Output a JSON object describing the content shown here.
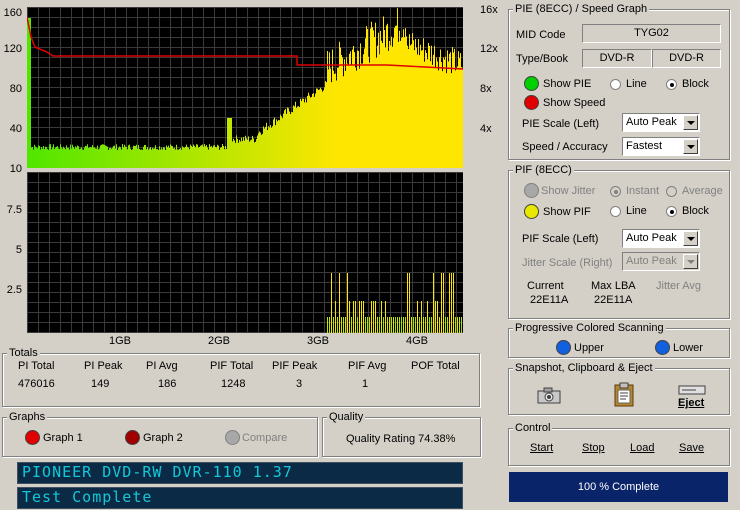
{
  "top_chart": {
    "left_axis": [
      "160",
      "120",
      "80",
      "40",
      "10"
    ],
    "right_axis": [
      "16x",
      "12x",
      "8x",
      "4x"
    ]
  },
  "bottom_chart": {
    "left_axis": [
      "7.5",
      "5",
      "2.5"
    ],
    "x_axis": [
      "1GB",
      "2GB",
      "3GB",
      "4GB"
    ]
  },
  "pie_panel": {
    "title": "PIE (8ECC) / Speed Graph",
    "mid_code_label": "MID Code",
    "mid_code_value": "TYG02",
    "type_book_label": "Type/Book",
    "type_value": "DVD-R",
    "book_value": "DVD-R",
    "show_pie": "Show PIE",
    "line": "Line",
    "block": "Block",
    "show_speed": "Show Speed",
    "pie_scale_label": "PIE Scale (Left)",
    "pie_scale_value": "Auto Peak",
    "speed_label": "Speed / Accuracy",
    "speed_value": "Fastest"
  },
  "pif_panel": {
    "title": "PIF (8ECC)",
    "show_jitter": "Show Jitter",
    "instant": "Instant",
    "average": "Average",
    "show_pif": "Show PIF",
    "line": "Line",
    "block": "Block",
    "pif_scale_label": "PIF Scale (Left)",
    "pif_scale_value": "Auto Peak",
    "jitter_scale_label": "Jitter Scale (Right)",
    "jitter_scale_value": "Auto Peak",
    "current_label": "Current",
    "current_value": "22E11A",
    "maxlba_label": "Max LBA",
    "maxlba_value": "22E11A",
    "jitter_avg_label": "Jitter Avg"
  },
  "progressive": {
    "title": "Progressive Colored Scanning",
    "upper": "Upper",
    "lower": "Lower"
  },
  "snapshot": {
    "title": "Snapshot,  Clipboard  & Eject",
    "eject": "Eject"
  },
  "control": {
    "title": "Control",
    "start": "Start",
    "stop": "Stop",
    "load": "Load",
    "save": "Save"
  },
  "progress": {
    "text": "100 % Complete",
    "fraction": 1.0
  },
  "totals": {
    "title": "Totals",
    "headers": [
      "PI Total",
      "PI Peak",
      "PI Avg",
      "PIF Total",
      "PIF Peak",
      "PIF Avg",
      "POF Total"
    ],
    "values": [
      "476016",
      "149",
      "186",
      "1248",
      "3",
      "1",
      ""
    ]
  },
  "graphs": {
    "title": "Graphs",
    "graph1": "Graph 1",
    "graph2": "Graph 2",
    "compare": "Compare"
  },
  "quality": {
    "title": "Quality",
    "rating": "Quality Rating 74.38%"
  },
  "drive_line": "PIONEER DVD-RW  DVR-110 1.37",
  "status_line": "Test Complete",
  "colors": {
    "pie_dot": "#00d000",
    "speed_dot": "#e00000",
    "pif_dot": "#e8e800",
    "graph1_dot": "#e00000",
    "graph2_dot": "#a00000",
    "upper_dot": "#1060e0",
    "progress_bg": "#0a246a"
  }
}
